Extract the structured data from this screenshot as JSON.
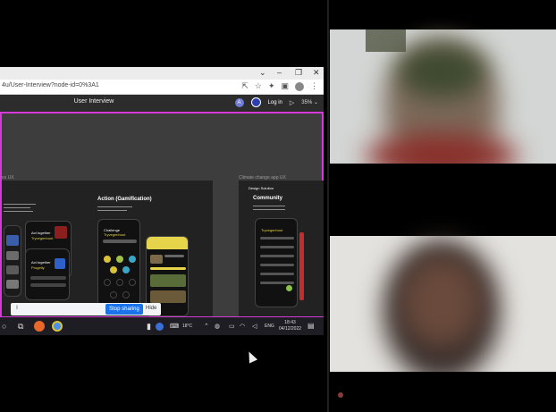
{
  "browser": {
    "url": "4u/User-Interview?node-id=0%3A1",
    "window_controls": [
      "⌄",
      "–",
      "❐",
      "✕"
    ],
    "toolbar_icons": [
      "share-icon",
      "star-icon",
      "extensions-icon",
      "sidepanel-icon",
      "profile-icon",
      "menu-icon"
    ]
  },
  "figma": {
    "title": "User Interview",
    "avatar_letter": "A",
    "login_label": "Log in",
    "zoom_label": "35% ⌄",
    "frame_labels": {
      "left": "es UX",
      "right": "Climate change app UX"
    },
    "action_frame": {
      "title": "Action (Gamification)"
    },
    "design_frame": {
      "header": "Design Solution",
      "title": "Community"
    },
    "phones": {
      "act_title": "Act together",
      "act_accent": "Tryvegenhout",
      "act2_title": "Act together",
      "act2_accent": "Progetly",
      "challenge_title": "Challenge",
      "challenge_accent": "Tryvegenhout",
      "community_accent": "Tryvegenhout"
    }
  },
  "share_bar": {
    "indicator": "ǁ",
    "stop_label": "Stop sharing",
    "hide_label": "Hide"
  },
  "taskbar": {
    "temperature": "18°C",
    "language": "ENG",
    "time": "18:43",
    "date": "04/12/2022"
  },
  "colors": {
    "accent_pink": "#d53ad8",
    "share_blue": "#1a73e8",
    "phone_yellow": "#e6d44a"
  }
}
